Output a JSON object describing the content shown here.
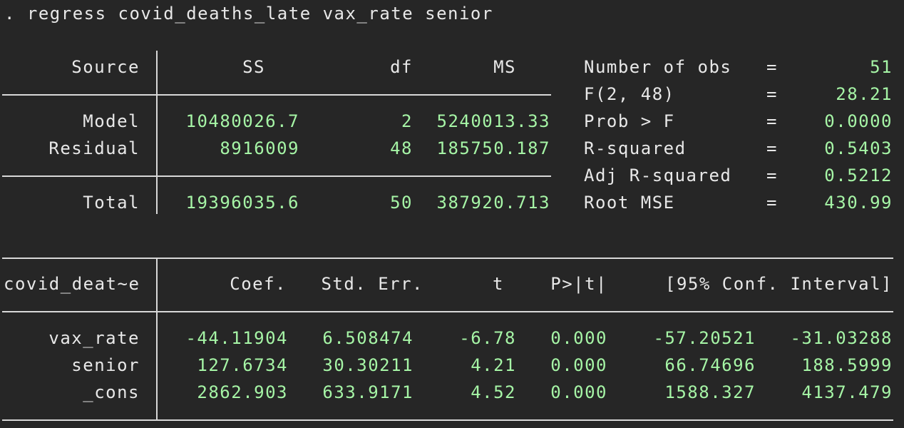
{
  "command": {
    "prompt": ".",
    "text": "regress covid_deaths_late vax_rate senior"
  },
  "anova": {
    "headers": {
      "source": "Source",
      "ss": "SS",
      "df": "df",
      "ms": "MS"
    },
    "rows": [
      {
        "source": "Model",
        "ss": "10480026.7",
        "df": "2",
        "ms": "5240013.33"
      },
      {
        "source": "Residual",
        "ss": "8916009",
        "df": "48",
        "ms": "185750.187"
      }
    ],
    "total": {
      "source": "Total",
      "ss": "19396035.6",
      "df": "50",
      "ms": "387920.713"
    }
  },
  "fit_stats": [
    {
      "label": "Number of obs",
      "eq": "=",
      "value": "51"
    },
    {
      "label": "F(2, 48)",
      "eq": "=",
      "value": "28.21"
    },
    {
      "label": "Prob > F",
      "eq": "=",
      "value": "0.0000"
    },
    {
      "label": "R-squared",
      "eq": "=",
      "value": "0.5403"
    },
    {
      "label": "Adj R-squared",
      "eq": "=",
      "value": "0.5212"
    },
    {
      "label": "Root MSE",
      "eq": "=",
      "value": "430.99"
    }
  ],
  "coef_table": {
    "depvar": "covid_deat~e",
    "headers": {
      "coef": "Coef.",
      "se": "Std. Err.",
      "t": "t",
      "p": "P>|t|",
      "ci": "[95% Conf. Interval]"
    },
    "rows": [
      {
        "var": "vax_rate",
        "coef": "-44.11904",
        "se": "6.508474",
        "t": "-6.78",
        "p": "0.000",
        "lo": "-57.20521",
        "hi": "-31.03288"
      },
      {
        "var": "senior",
        "coef": "127.6734",
        "se": "30.30211",
        "t": "4.21",
        "p": "0.000",
        "lo": "66.74696",
        "hi": "188.5999"
      },
      {
        "var": "_cons",
        "coef": "2862.903",
        "se": "633.9171",
        "t": "4.52",
        "p": "0.000",
        "lo": "1588.327",
        "hi": "4137.479"
      }
    ]
  },
  "colors": {
    "background": "#262626",
    "text": "#e8e8e8",
    "value": "#a6f5a6",
    "rule": "#d8d8d8"
  }
}
